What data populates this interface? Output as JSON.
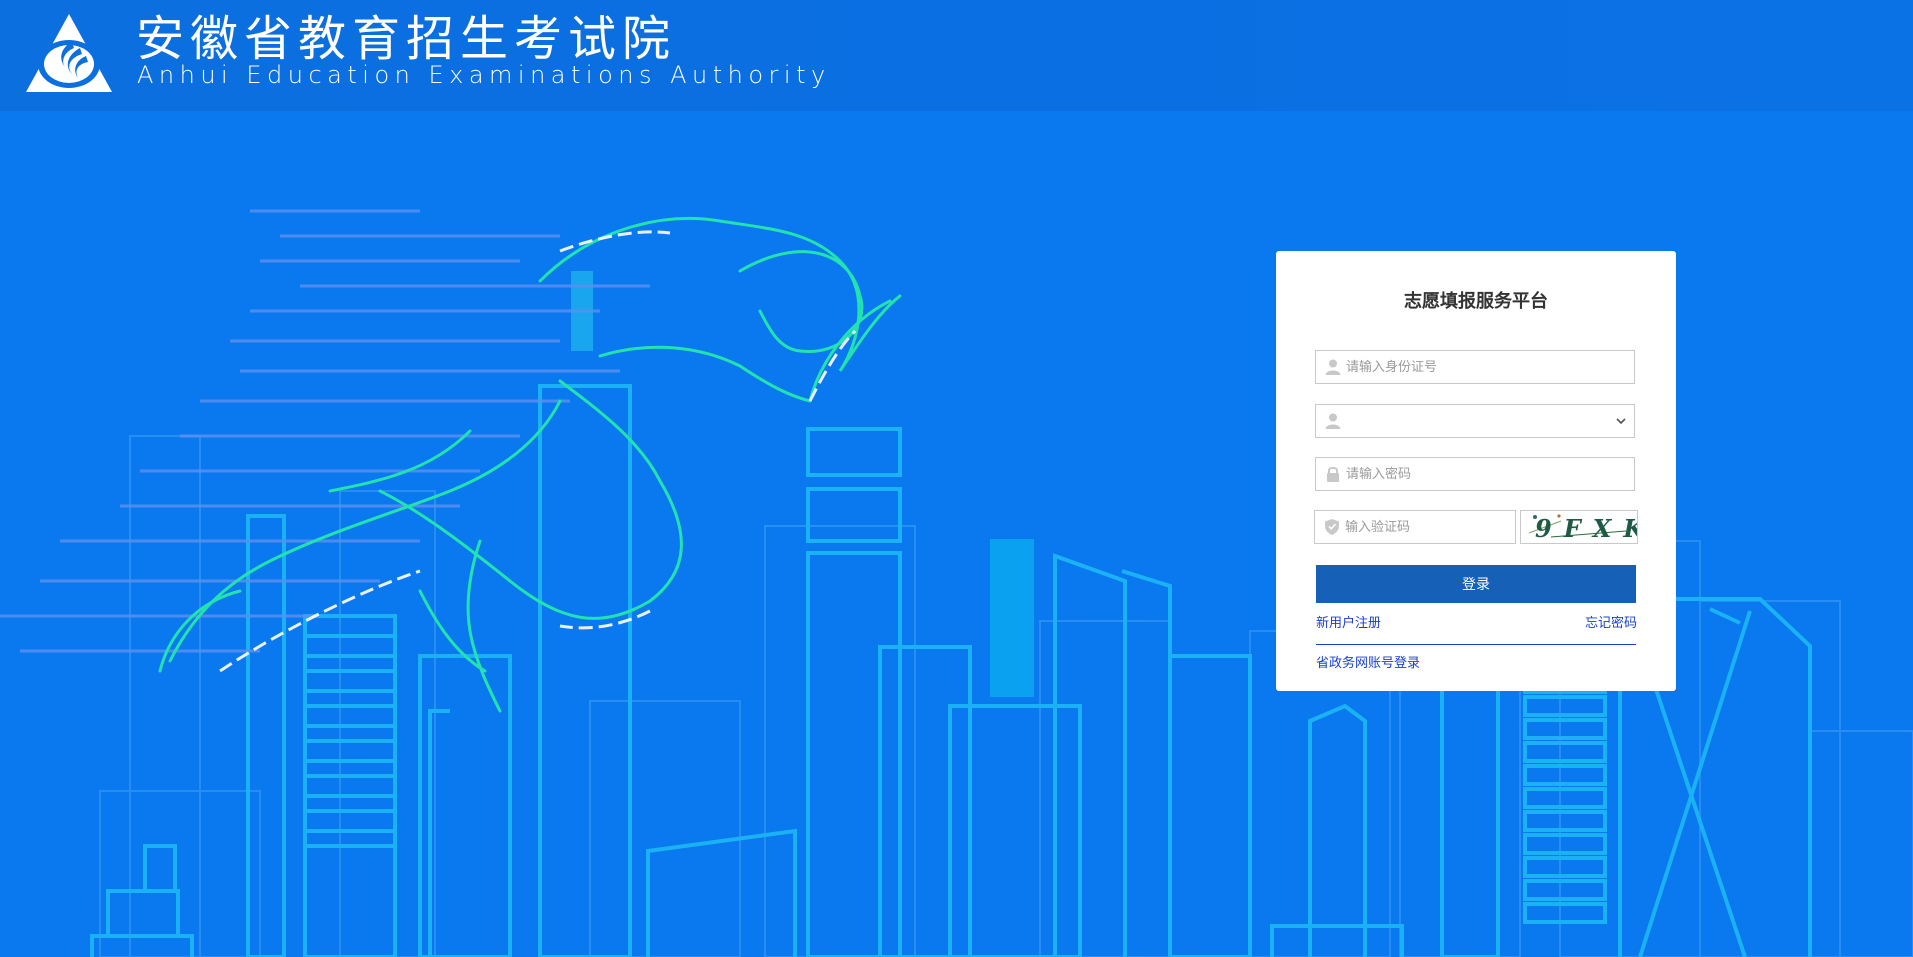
{
  "header": {
    "title_cn": "安徽省教育招生考试院",
    "title_en": "Anhui Education Examinations Authority"
  },
  "login": {
    "title": "志愿填报服务平台",
    "id_placeholder": "请输入身份证号",
    "select_value": "",
    "password_placeholder": "请输入密码",
    "captcha_placeholder": "输入验证码",
    "captcha_text": "9FXK",
    "login_label": "登录",
    "register_link": "新用户注册",
    "forgot_link": "忘记密码",
    "gov_login_link": "省政务网账号登录"
  },
  "colors": {
    "background": "#0a78ee",
    "header": "#0c6fe0",
    "login_button": "#1660b8",
    "link": "#1a3fd0",
    "runner": "#22e3b0",
    "buildings": "#1ab2f4"
  },
  "icons": [
    "logo-emblem",
    "user-icon",
    "user-select-icon",
    "chevron-down-icon",
    "lock-icon",
    "shield-icon"
  ]
}
